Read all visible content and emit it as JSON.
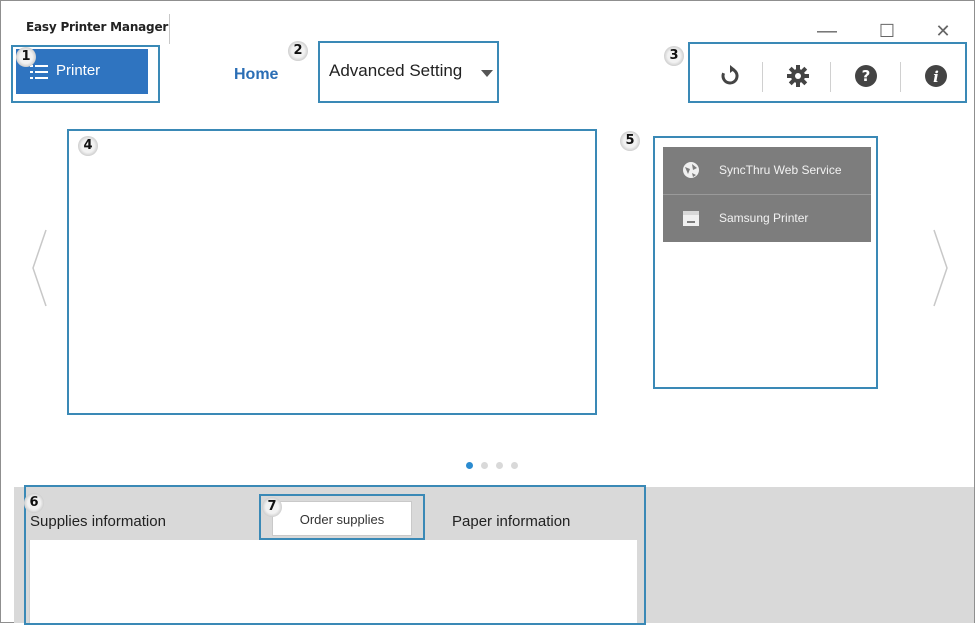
{
  "window": {
    "title": "Easy Printer Manager",
    "controls": {
      "minimize": "—",
      "maximize": "☐",
      "close": "✕"
    }
  },
  "header": {
    "printer_button": "Printer",
    "home_link": "Home",
    "advanced_setting": "Advanced Setting"
  },
  "toolbar": {
    "icons": [
      "refresh-icon",
      "gear-icon",
      "help-icon",
      "info-icon"
    ]
  },
  "side_menu": {
    "items": [
      {
        "label": "SyncThru Web Service",
        "icon": "globe-icon"
      },
      {
        "label": "Samsung Printer",
        "icon": "printer-folder-icon"
      }
    ]
  },
  "pager": {
    "pages": 4,
    "active": 1
  },
  "bottom_panel": {
    "supplies_label": "Supplies information",
    "order_button": "Order supplies",
    "paper_label": "Paper information"
  },
  "callouts": [
    "1",
    "2",
    "3",
    "4",
    "5",
    "6",
    "7"
  ],
  "colors": {
    "accent": "#2f74c0",
    "callout_border": "#3a89b6",
    "menu_gray": "#7d7d7d",
    "bottom_gray": "#d9d9d9",
    "active_dot": "#2b8bd0"
  }
}
